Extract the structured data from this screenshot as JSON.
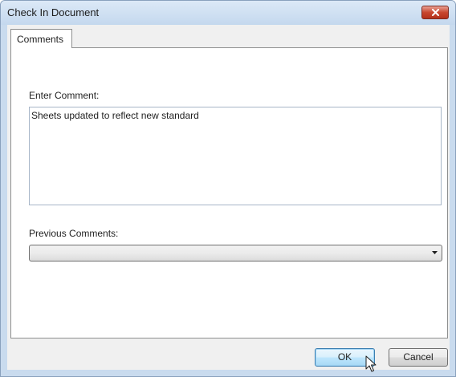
{
  "window": {
    "title": "Check In Document"
  },
  "tabs": [
    {
      "label": "Comments",
      "selected": true
    }
  ],
  "form": {
    "enter_comment_label": "Enter Comment:",
    "comment_value": "Sheets updated to reflect new standard",
    "previous_comments_label": "Previous Comments:",
    "previous_comments_value": ""
  },
  "buttons": {
    "ok_label": "OK",
    "cancel_label": "Cancel"
  },
  "icons": {
    "close": "close-icon",
    "dropdown": "chevron-down-icon",
    "cursor": "mouse-pointer-icon"
  },
  "colors": {
    "titlebar": "#c9dbee",
    "close_button": "#c8472f",
    "ok_button_border": "#3c7fb1"
  }
}
